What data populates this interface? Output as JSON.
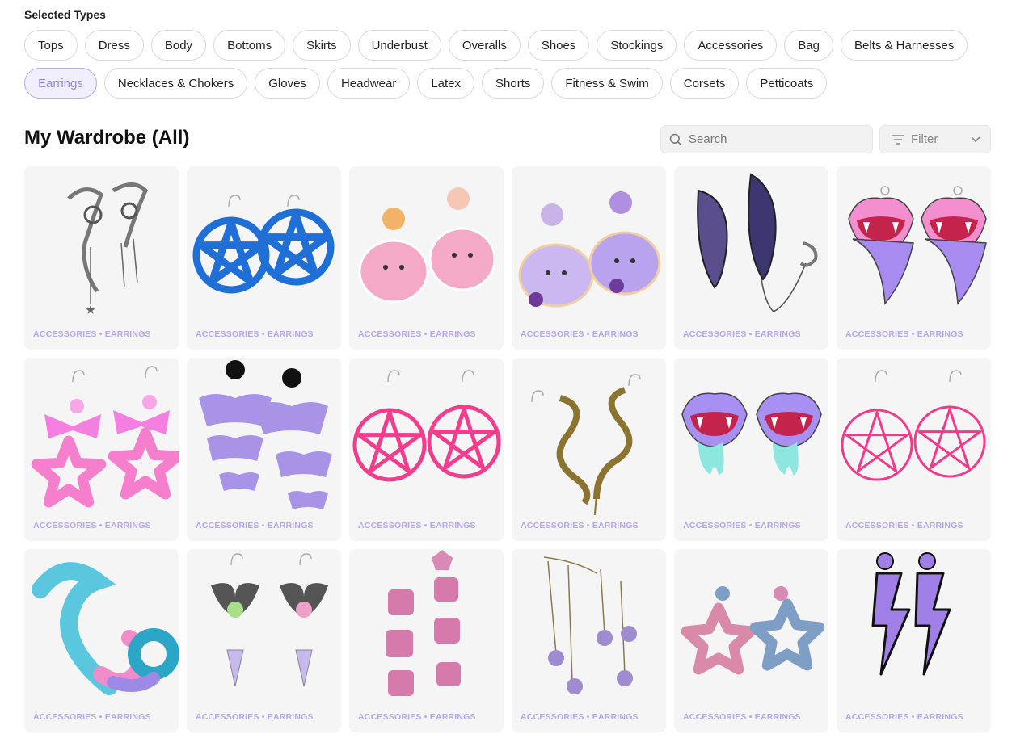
{
  "filters": {
    "label": "Selected Types",
    "row1": [
      "Tops",
      "Dress",
      "Body",
      "Bottoms",
      "Skirts",
      "Underbust",
      "Overalls",
      "Shoes",
      "Stockings",
      "Accessories",
      "Bag",
      "Belts & Harnesses"
    ],
    "row2": [
      "Earrings",
      "Necklaces & Chokers",
      "Gloves",
      "Headwear",
      "Latex",
      "Shorts",
      "Fitness & Swim",
      "Corsets",
      "Petticoats"
    ],
    "selected": "Earrings"
  },
  "wardrobe": {
    "title": "My Wardrobe (All)",
    "search_placeholder": "Search",
    "filter_label": "Filter"
  },
  "items": [
    {
      "tag": "ACCESSORIES • EARRINGS",
      "art": "silver-ear-cuff"
    },
    {
      "tag": "ACCESSORIES • EARRINGS",
      "art": "blue-pentagram"
    },
    {
      "tag": "ACCESSORIES • EARRINGS",
      "art": "pink-creature"
    },
    {
      "tag": "ACCESSORIES • EARRINGS",
      "art": "purple-creature"
    },
    {
      "tag": "ACCESSORIES • EARRINGS",
      "art": "moth-wing"
    },
    {
      "tag": "ACCESSORIES • EARRINGS",
      "art": "vampire-lips-pink"
    },
    {
      "tag": "ACCESSORIES • EARRINGS",
      "art": "pink-bow-star"
    },
    {
      "tag": "ACCESSORIES • EARRINGS",
      "art": "purple-bats"
    },
    {
      "tag": "ACCESSORIES • EARRINGS",
      "art": "pink-pentagram"
    },
    {
      "tag": "ACCESSORIES • EARRINGS",
      "art": "snake-gold"
    },
    {
      "tag": "ACCESSORIES • EARRINGS",
      "art": "vampire-lips-purple"
    },
    {
      "tag": "ACCESSORIES • EARRINGS",
      "art": "pink-pentagram-thin"
    },
    {
      "tag": "ACCESSORIES • EARRINGS",
      "art": "tentacle-gauges"
    },
    {
      "tag": "ACCESSORIES • EARRINGS",
      "art": "bat-crystal"
    },
    {
      "tag": "ACCESSORIES • EARRINGS",
      "art": "pink-dice"
    },
    {
      "tag": "ACCESSORIES • EARRINGS",
      "art": "purple-flower-chain"
    },
    {
      "tag": "ACCESSORIES • EARRINGS",
      "art": "pastel-star"
    },
    {
      "tag": "ACCESSORIES • EARRINGS",
      "art": "purple-lightning"
    }
  ]
}
